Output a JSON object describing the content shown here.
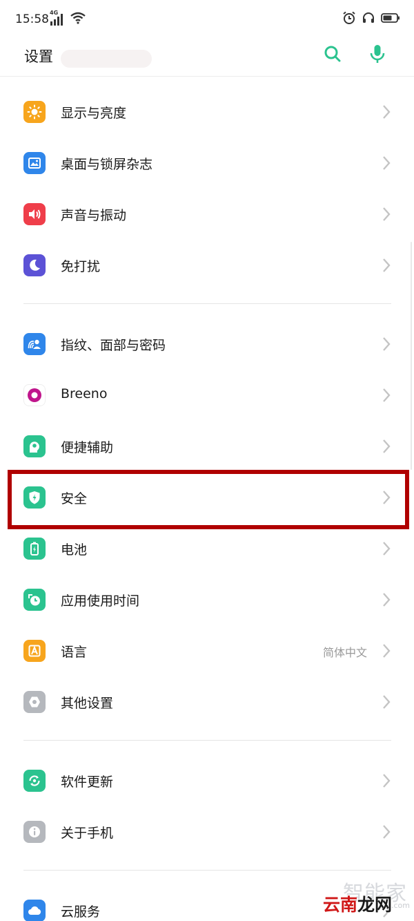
{
  "status_bar": {
    "time": "15:58",
    "network": "4G"
  },
  "header": {
    "title": "设置"
  },
  "colors": {
    "accent": "#2bc38f",
    "highlight": "#b00000"
  },
  "sections": [
    {
      "items": [
        {
          "label": "显示与亮度",
          "icon": "brightness-icon",
          "color": "#f7a51d"
        },
        {
          "label": "桌面与锁屏杂志",
          "icon": "wallpaper-icon",
          "color": "#2f86ea"
        },
        {
          "label": "声音与振动",
          "icon": "speaker-icon",
          "color": "#ef3e4a"
        },
        {
          "label": "免打扰",
          "icon": "moon-icon",
          "color": "#5c52d6"
        }
      ]
    },
    {
      "items": [
        {
          "label": "指纹、面部与密码",
          "icon": "face-fingerprint-icon",
          "color": "#2f86ea"
        },
        {
          "label": "Breeno",
          "icon": "breeno-icon",
          "color": "#ffffff"
        },
        {
          "label": "便捷辅助",
          "icon": "assist-icon",
          "color": "#2bc38f"
        },
        {
          "label": "安全",
          "icon": "shield-icon",
          "color": "#2bc38f"
        },
        {
          "label": "电池",
          "icon": "battery-icon",
          "color": "#2bc38f"
        },
        {
          "label": "应用使用时间",
          "icon": "app-timer-icon",
          "color": "#2bc38f"
        },
        {
          "label": "语言",
          "icon": "language-icon",
          "color": "#f7a51d",
          "value": "简体中文"
        },
        {
          "label": "其他设置",
          "icon": "gear-icon",
          "color": "#b5b8bd"
        }
      ]
    },
    {
      "items": [
        {
          "label": "软件更新",
          "icon": "update-icon",
          "color": "#2bc38f"
        },
        {
          "label": "关于手机",
          "icon": "info-icon",
          "color": "#b5b8bd"
        }
      ]
    },
    {
      "items": [
        {
          "label": "云服务",
          "icon": "cloud-icon",
          "color": "#2f86ea"
        }
      ]
    }
  ],
  "watermark": {
    "top": "智能家",
    "url": "...com",
    "main_red": "云南",
    "main_rest": "龙网"
  }
}
